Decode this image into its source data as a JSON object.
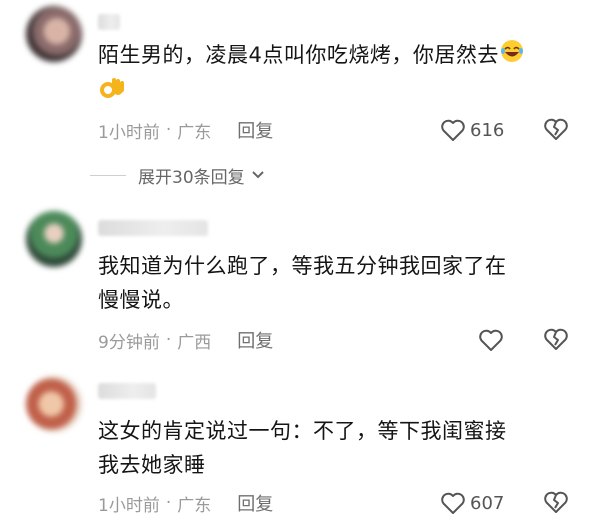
{
  "comments": [
    {
      "text": "陌生男的，凌晨4点叫你吃烧烤，你居然去",
      "time": "1小时前",
      "location": "广东",
      "reply_label": "回复",
      "likes": "616",
      "emojis": [
        "rolling-laughing-emoji",
        "ok-hand-emoji"
      ]
    },
    {
      "text_line1": "我知道为什么跑了，等我五分钟我回家了在",
      "text_line2": "慢慢说。",
      "time": "9分钟前",
      "location": "广西",
      "reply_label": "回复",
      "likes": ""
    },
    {
      "text_line1": "这女的肯定说过一句：不了，等下我闺蜜接",
      "text_line2": "我去她家睡",
      "time": "1小时前",
      "location": "广东",
      "reply_label": "回复",
      "likes": "607"
    }
  ],
  "expand_replies": {
    "label": "展开30条回复"
  },
  "separator": "·",
  "icons": [
    "heart-icon",
    "broken-heart-icon",
    "chevron-down-icon"
  ]
}
